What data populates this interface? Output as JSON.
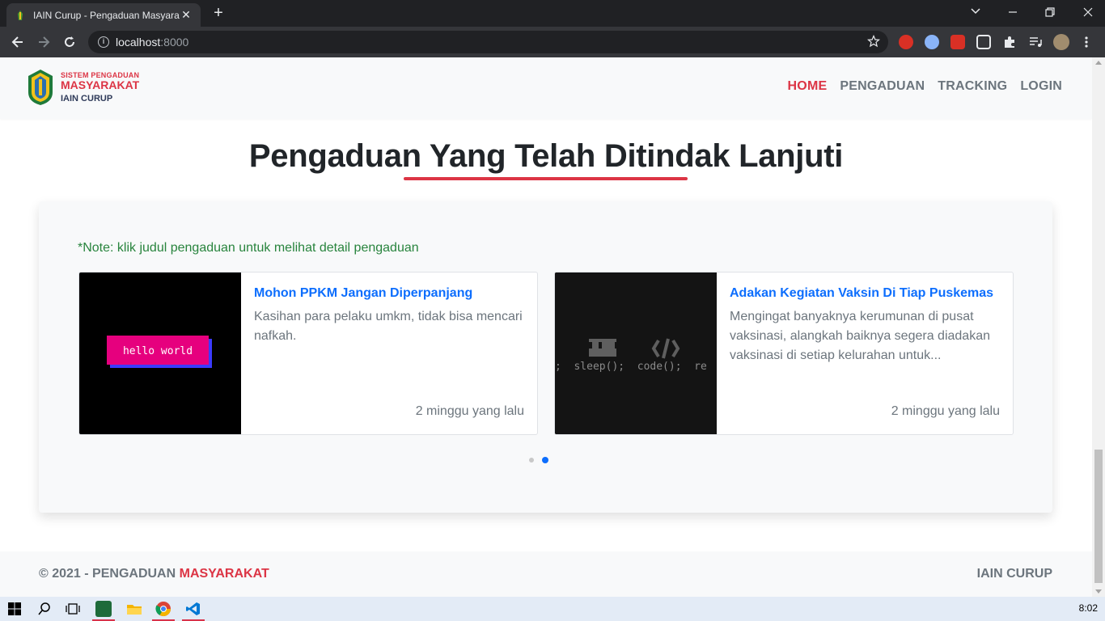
{
  "browser": {
    "tab_title": "IAIN Curup - Pengaduan Masyarakat",
    "close_glyph": "✕",
    "new_tab_glyph": "+",
    "url_host": "localhost",
    "url_port": ":8000"
  },
  "navbar": {
    "logo": {
      "line1": "SISTEM PENGADUAN",
      "line2": "MASYARAKAT",
      "line3": "IAIN CURUP"
    },
    "menu": [
      {
        "label": "HOME",
        "active": true
      },
      {
        "label": "PENGADUAN",
        "active": false
      },
      {
        "label": "TRACKING",
        "active": false
      },
      {
        "label": "LOGIN",
        "active": false
      }
    ]
  },
  "main": {
    "section_title": "Pengaduan Yang Telah Ditindak Lanjuti",
    "note": "*Note: klik judul pengaduan untuk melihat detail pengaduan",
    "cards": [
      {
        "image_text": "hello world",
        "title": "Mohon PPKM Jangan Diperpanjang",
        "excerpt": "Kasihan para pelaku umkm, tidak bisa mencari nafkah.",
        "time": "2 minggu yang lalu"
      },
      {
        "image_text": ";  sleep();  code();  re",
        "title": "Adakan Kegiatan Vaksin Di Tiap Puskemas",
        "excerpt": "Mengingat banyaknya kerumunan di pusat vaksinasi, alangkah baiknya segera diadakan vaksinasi di setiap kelurahan untuk...",
        "time": "2 minggu yang lalu"
      }
    ],
    "carousel": {
      "total": 2,
      "active_index": 1
    }
  },
  "footer": {
    "left_prefix": "© 2021 - PENGADUAN ",
    "left_brand": "MASYARAKAT",
    "right": "IAIN CURUP"
  },
  "taskbar": {
    "clock": "8:02"
  },
  "colors": {
    "accent_red": "#dc3545",
    "link_blue": "#0d6efd",
    "note_green": "#28843d"
  }
}
